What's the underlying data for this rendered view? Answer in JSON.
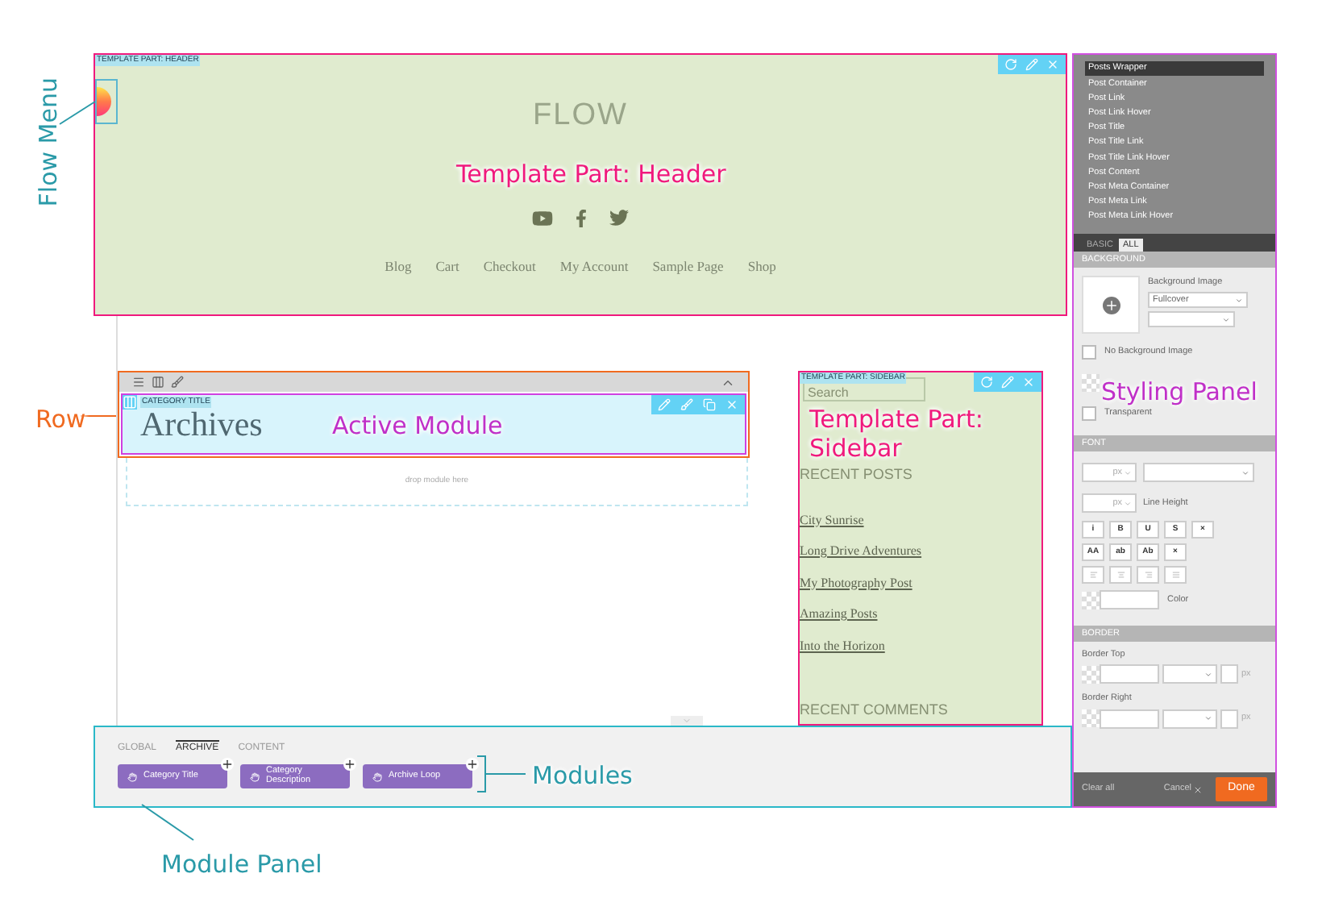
{
  "header_part": {
    "label": "TEMPLATE PART: HEADER",
    "site_title": "FLOW",
    "nav": [
      "Blog",
      "Cart",
      "Checkout",
      "My Account",
      "Sample Page",
      "Shop"
    ]
  },
  "row": {
    "module": {
      "label": "CATEGORY TITLE",
      "heading": "Archives"
    },
    "drop_hint": "drop module here"
  },
  "sidebar_part": {
    "label": "TEMPLATE PART: SIDEBAR",
    "search_placeholder": "Search",
    "recent_posts_title": "RECENT POSTS",
    "posts": [
      "City Sunrise",
      "Long Drive Adventures",
      "My Photography Post",
      "Amazing Posts",
      "Into the Horizon"
    ],
    "recent_comments_title": "RECENT COMMENTS"
  },
  "module_panel": {
    "tabs": [
      {
        "label": "GLOBAL",
        "selected": false
      },
      {
        "label": "ARCHIVE",
        "selected": true
      },
      {
        "label": "CONTENT",
        "selected": false
      }
    ],
    "modules": [
      "Category Title",
      "Category Description",
      "Archive Loop"
    ]
  },
  "styling_panel": {
    "elements": [
      {
        "label": "Posts Wrapper",
        "selected": true
      },
      {
        "label": "Post Container",
        "selected": false
      },
      {
        "label": "Post Link",
        "selected": false
      },
      {
        "label": "Post Link Hover",
        "selected": false
      },
      {
        "label": "Post Title",
        "selected": false
      },
      {
        "label": "Post Title Link",
        "selected": false
      },
      {
        "label": "Post Title Link Hover",
        "selected": false
      },
      {
        "label": "Post Content",
        "selected": false
      },
      {
        "label": "Post Meta Container",
        "selected": false
      },
      {
        "label": "Post Meta Link",
        "selected": false
      },
      {
        "label": "Post Meta Link Hover",
        "selected": false
      }
    ],
    "tabs": [
      {
        "label": "BASIC",
        "selected": false
      },
      {
        "label": "ALL",
        "selected": true
      }
    ],
    "background": {
      "title": "BACKGROUND",
      "image_label": "Background Image",
      "size_value": "Fullcover",
      "checkboxes": [
        {
          "label": "No Background Image",
          "checked": false
        },
        {
          "label": "Transparent",
          "checked": false
        }
      ]
    },
    "font": {
      "title": "FONT",
      "size_unit": "px",
      "line_height_unit": "px",
      "line_height_label": "Line Height",
      "style_buttons": [
        "i",
        "B",
        "U",
        "S",
        "×"
      ],
      "case_buttons": [
        "AA",
        "ab",
        "Ab",
        "×"
      ],
      "color_label": "Color"
    },
    "border": {
      "title": "BORDER",
      "fields": [
        {
          "label": "Border Top",
          "unit": "px"
        },
        {
          "label": "Border Right",
          "unit": "px"
        }
      ]
    },
    "footer": {
      "clear_all": "Clear all",
      "cancel": "Cancel",
      "done": "Done"
    }
  },
  "annotations": [
    {
      "text": "Flow Menu",
      "kind": "vertical",
      "color": "#2a9aa8"
    },
    {
      "text": "Template Part: Header",
      "kind": "overlay",
      "color": "#f0197d"
    },
    {
      "text": "Row",
      "kind": "side",
      "color": "#f06a20"
    },
    {
      "text": "Active Module",
      "kind": "overlay",
      "color": "#c030c8"
    },
    {
      "text": "Template Part: Sidebar",
      "kind": "overlay",
      "color": "#f0197d"
    },
    {
      "text": "Styling Panel",
      "kind": "overlay",
      "color": "#c030c8"
    },
    {
      "text": "Modules",
      "kind": "side",
      "color": "#2a9aa8"
    },
    {
      "text": "Module Panel",
      "kind": "side",
      "color": "#2a9aa8"
    }
  ]
}
